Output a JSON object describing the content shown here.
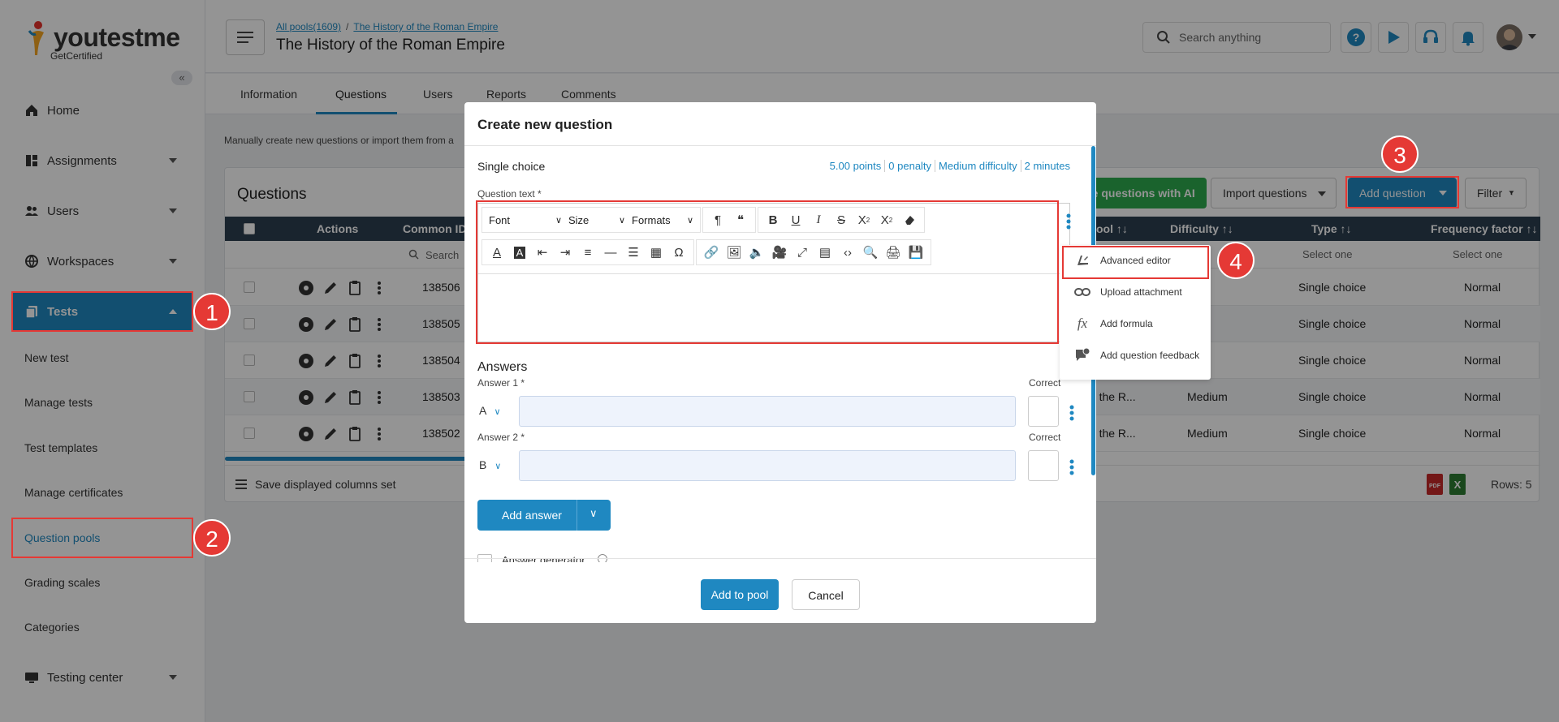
{
  "brand": {
    "name": "youtestme",
    "tagline": "GetCertified"
  },
  "sidebar": {
    "collapse_label": "«",
    "items": [
      {
        "label": "Home"
      },
      {
        "label": "Assignments"
      },
      {
        "label": "Users"
      },
      {
        "label": "Workspaces"
      },
      {
        "label": "Tests"
      },
      {
        "label": "Testing center"
      }
    ],
    "sub_items": [
      {
        "label": "New test"
      },
      {
        "label": "Manage tests"
      },
      {
        "label": "Test templates"
      },
      {
        "label": "Manage certificates"
      },
      {
        "label": "Question pools"
      },
      {
        "label": "Grading scales"
      },
      {
        "label": "Categories"
      }
    ]
  },
  "header": {
    "breadcrumb": [
      "All pools(1609)",
      "The History of the Roman Empire"
    ],
    "breadcrumb_sep": "/",
    "title": "The History of the Roman Empire",
    "search_placeholder": "Search anything"
  },
  "tabs": [
    {
      "label": "Information"
    },
    {
      "label": "Questions"
    },
    {
      "label": "Users"
    },
    {
      "label": "Reports"
    },
    {
      "label": "Comments"
    }
  ],
  "intro_text": "Manually create new questions or import them from a",
  "questions": {
    "title": "Questions",
    "generate_ai_label": "te questions with AI",
    "import_label": "Import questions",
    "add_label": "Add question",
    "filter_label": "Filter",
    "columns": {
      "actions": "Actions",
      "common_id": "Common ID",
      "pool": "ool ↑↓",
      "difficulty": "Difficulty ↑↓",
      "type": "Type ↑↓",
      "frequency": "Frequency factor ↑↓"
    },
    "filter_search": "Search",
    "filter_select": "Select one",
    "rows": [
      {
        "id": "138506",
        "pool": "",
        "difficulty": "",
        "type": "Single choice",
        "frequency": "Normal"
      },
      {
        "id": "138505",
        "pool": "",
        "difficulty": "",
        "type": "Single choice",
        "frequency": "Normal"
      },
      {
        "id": "138504",
        "pool": "",
        "difficulty": "",
        "type": "Single choice",
        "frequency": "Normal"
      },
      {
        "id": "138503",
        "pool": "of the R...",
        "difficulty": "Medium",
        "type": "Single choice",
        "frequency": "Normal"
      },
      {
        "id": "138502",
        "pool": "of the R...",
        "difficulty": "Medium",
        "type": "Single choice",
        "frequency": "Normal"
      }
    ],
    "save_columns_label": "Save displayed columns set",
    "rows_count": "Rows: 5"
  },
  "modal": {
    "title": "Create new question",
    "question_type": "Single choice",
    "meta": [
      "5.00 points",
      "0 penalty",
      "Medium difficulty",
      "2 minutes"
    ],
    "question_text_label": "Question text *",
    "toolbar": {
      "font": "Font",
      "size": "Size",
      "formats": "Formats",
      "omega": "Ω"
    },
    "answers_heading": "Answers",
    "answers": [
      {
        "label": "Answer 1 *",
        "letter": "A",
        "value": "",
        "correct_label": "Correct"
      },
      {
        "label": "Answer 2 *",
        "letter": "B",
        "value": "",
        "correct_label": "Correct"
      }
    ],
    "add_answer_label": "Add answer",
    "answer_generator_label": "Answer generator",
    "add_to_pool_label": "Add to pool",
    "cancel_label": "Cancel"
  },
  "dropdown": {
    "items": [
      {
        "label": "Advanced editor"
      },
      {
        "label": "Upload attachment"
      },
      {
        "label": "Add formula"
      },
      {
        "label": "Add question feedback"
      }
    ]
  },
  "annotations": [
    "1",
    "2",
    "3",
    "4"
  ],
  "colors": {
    "primary": "#1f88c1",
    "highlight": "#e53935",
    "ai_button": "#2eab4f",
    "table_header": "#2c3e50"
  }
}
